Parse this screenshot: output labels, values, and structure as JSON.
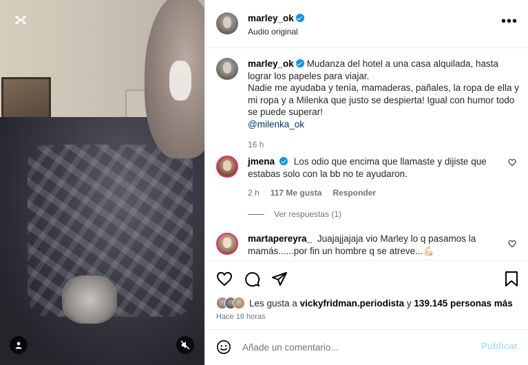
{
  "post": {
    "author": "marley_ok",
    "audio": "Audio original",
    "more_icon": "more-horizontal-icon"
  },
  "caption": {
    "username": "marley_ok",
    "text": "Mudanza del hotel a una casa alquilada, hasta lograr los papeles para viajar.",
    "text2": "Nadie me ayudaba y tenía, mamaderas, pañales, la ropa de ella y mi ropa y a Milenka que justo se despierta! Igual con humor todo se puede superar!",
    "mention": "@milenka_ok",
    "time": "16 h"
  },
  "comments": [
    {
      "username": "jmena",
      "verified": true,
      "text": "Los odio que encima que llamaste y dijiste que estabas solo con la bb no te ayudaron.",
      "time": "2 h",
      "likes": "117 Me gusta",
      "reply": "Responder"
    },
    {
      "username": "martapereyra_",
      "verified": false,
      "text": "Juajajjajaja vio Marley lo q pasamos la mamás......por fin un hombre q se atreve...💪🏻"
    }
  ],
  "replies": {
    "label": "Ver respuestas (1)"
  },
  "likes": {
    "prefix": "Les gusta a",
    "user": "vickyfridman.periodista",
    "joiner": "y",
    "others": "139.145 personas más"
  },
  "posted": "Hace 16 horas",
  "composer": {
    "placeholder": "Añade un comentario...",
    "post_label": "Publicar"
  },
  "colors": {
    "verified": "#0095f6",
    "story_ring": "#e1306c",
    "link": "#00376b",
    "muted": "#737373",
    "post_disabled": "#b2dffc"
  }
}
